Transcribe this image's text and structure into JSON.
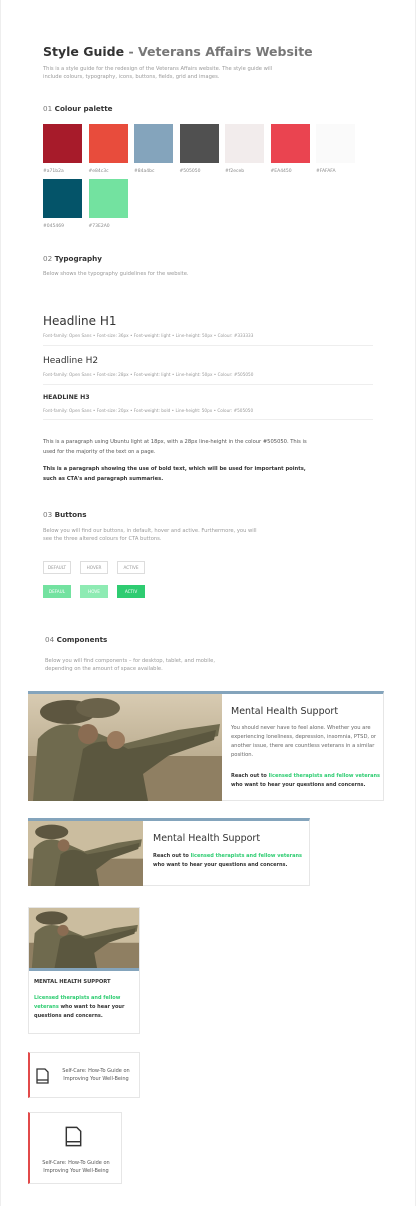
{
  "header": {
    "title": "Style Guide",
    "title_sub": " - Veterans Affairs Website",
    "intro": "This is a style guide for the redesign of the Veterans Affairs website. The style guide will include colours, typography, icons, buttons, fields, grid and images."
  },
  "palette": {
    "num": "01",
    "title": "Colour palette",
    "colors": [
      {
        "hex": "#a71b2a",
        "label": "#a71b2a"
      },
      {
        "hex": "#e84c3c",
        "label": "#e84c3c"
      },
      {
        "hex": "#84a4bc",
        "label": "#84a4bc"
      },
      {
        "hex": "#505050",
        "label": "#505050"
      },
      {
        "hex": "#f2ecec",
        "label": "#f2eceb"
      },
      {
        "hex": "#EA4450",
        "label": "#EA4450"
      },
      {
        "hex": "#FAFAFA",
        "label": "#FAFAFA"
      },
      {
        "hex": "#045469",
        "label": "#045469"
      },
      {
        "hex": "#73E2A0",
        "label": "#73E2A0"
      }
    ]
  },
  "typography": {
    "num": "02",
    "title": "Typography",
    "desc": "Below shows the typography guidelines for the website.",
    "h1": "Headline H1",
    "h1_spec": "Font-family: Open Sans  •  Font-size: 36px  •  Font-weight: light  •  Line-height: 50px  •  Colour: #333333",
    "h2": "Headline H2",
    "h2_spec": "Font-family: Open Sans  •  Font-size: 28px  •  Font-weight: light  •  Line-height: 50px  •  Colour: #505050",
    "h3": "HEADLINE H3",
    "h3_spec": "Font-family: Open Sans  •  Font-size: 20px  •  Font-weight: bold  •  Line-height: 50px  •  Colour: #505050",
    "para1": "This is a paragraph using Ubuntu light at 18px, with a 28px line-height in the colour #505050. This is used for the majority of the text on a page.",
    "para2": "This is a paragraph showing the use of bold text, which will be used for important points, such as CTA's and paragraph summaries."
  },
  "buttons": {
    "num": "03",
    "title": "Buttons",
    "desc": "Below you will find our buttons, in default, hover and active. Furthermore, you will see the three altered colours for CTA buttons.",
    "outline": [
      "DEFAULT",
      "HOVER",
      "ACTIVE"
    ],
    "filled": [
      {
        "label": "DEFAUL",
        "color": "#73E2A0"
      },
      {
        "label": "HOVE",
        "color": "#8EEBB3"
      },
      {
        "label": "ACTIV",
        "color": "#2ecc71"
      }
    ]
  },
  "components": {
    "num": "04",
    "title": "Components",
    "desc": "Below you will find components – for desktop, tablet, and mobile, depending on the amount of space available.",
    "card_title": "Mental Health Support",
    "card_text": "You should never have to feel alone. Whether you are experiencing loneliness, depression, insomnia, PTSD, or another issue, there are countless veterans in a similar position.",
    "cta_pre": "Reach out to ",
    "cta_link": "licensed therapists and fellow veterans",
    "cta_post": " who want to hear your questions and concerns.",
    "mobile_title": "MENTAL HEALTH SUPPORT",
    "mobile_link": "Licensed therapists and fellow veterans",
    "mobile_post": " who want to hear your questions and concerns.",
    "guide_text": "Self-Care: How-To Guide on Improving Your Well-Being",
    "accent": "#84a4bc"
  }
}
